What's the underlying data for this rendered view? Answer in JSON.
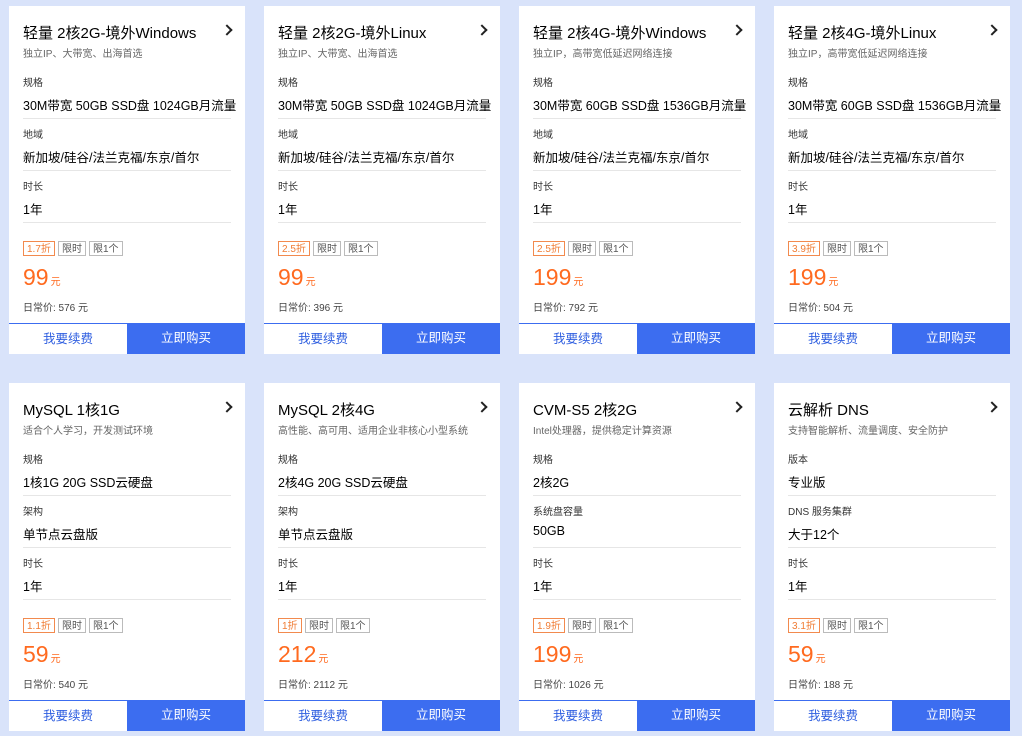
{
  "cards": [
    {
      "title": "轻量 2核2G-境外Windows",
      "subtitle": "独立IP、大带宽、出海首选",
      "row1_label": "规格",
      "row1_value": "30M带宽 50GB SSD盘 1024GB月流量",
      "row2_label": "地域",
      "row2_value": "新加坡/硅谷/法兰克福/东京/首尔",
      "row3_label": "时长",
      "row3_value": "1年",
      "discount": "1.7折",
      "tag_limited": "限时",
      "tag_limit_one": "限1个",
      "price": "99",
      "price_unit": "元",
      "original_price": "日常价: 576 元",
      "renew_label": "我要续费",
      "buy_label": "立即购买"
    },
    {
      "title": "轻量 2核2G-境外Linux",
      "subtitle": "独立IP、大带宽、出海首选",
      "row1_label": "规格",
      "row1_value": "30M带宽 50GB SSD盘 1024GB月流量",
      "row2_label": "地域",
      "row2_value": "新加坡/硅谷/法兰克福/东京/首尔",
      "row3_label": "时长",
      "row3_value": "1年",
      "discount": "2.5折",
      "tag_limited": "限时",
      "tag_limit_one": "限1个",
      "price": "99",
      "price_unit": "元",
      "original_price": "日常价: 396 元",
      "renew_label": "我要续费",
      "buy_label": "立即购买"
    },
    {
      "title": "轻量 2核4G-境外Windows",
      "subtitle": "独立IP，高带宽低延迟网络连接",
      "row1_label": "规格",
      "row1_value": "30M带宽 60GB SSD盘 1536GB月流量",
      "row2_label": "地域",
      "row2_value": "新加坡/硅谷/法兰克福/东京/首尔",
      "row3_label": "时长",
      "row3_value": "1年",
      "discount": "2.5折",
      "tag_limited": "限时",
      "tag_limit_one": "限1个",
      "price": "199",
      "price_unit": "元",
      "original_price": "日常价: 792 元",
      "renew_label": "我要续费",
      "buy_label": "立即购买"
    },
    {
      "title": "轻量 2核4G-境外Linux",
      "subtitle": "独立IP，高带宽低延迟网络连接",
      "row1_label": "规格",
      "row1_value": "30M带宽 60GB SSD盘 1536GB月流量",
      "row2_label": "地域",
      "row2_value": "新加坡/硅谷/法兰克福/东京/首尔",
      "row3_label": "时长",
      "row3_value": "1年",
      "discount": "3.9折",
      "tag_limited": "限时",
      "tag_limit_one": "限1个",
      "price": "199",
      "price_unit": "元",
      "original_price": "日常价: 504 元",
      "renew_label": "我要续费",
      "buy_label": "立即购买"
    },
    {
      "title": "MySQL 1核1G",
      "subtitle": "适合个人学习，开发测试环境",
      "row1_label": "规格",
      "row1_value": "1核1G 20G SSD云硬盘",
      "row2_label": "架构",
      "row2_value": "单节点云盘版",
      "row3_label": "时长",
      "row3_value": "1年",
      "discount": "1.1折",
      "tag_limited": "限时",
      "tag_limit_one": "限1个",
      "price": "59",
      "price_unit": "元",
      "original_price": "日常价: 540 元",
      "renew_label": "我要续费",
      "buy_label": "立即购买"
    },
    {
      "title": "MySQL 2核4G",
      "subtitle": "高性能、高可用、适用企业非核心小型系统",
      "row1_label": "规格",
      "row1_value": "2核4G 20G SSD云硬盘",
      "row2_label": "架构",
      "row2_value": "单节点云盘版",
      "row3_label": "时长",
      "row3_value": "1年",
      "discount": "1折",
      "tag_limited": "限时",
      "tag_limit_one": "限1个",
      "price": "212",
      "price_unit": "元",
      "original_price": "日常价: 2112 元",
      "renew_label": "我要续费",
      "buy_label": "立即购买"
    },
    {
      "title": "CVM-S5 2核2G",
      "subtitle": "Intel处理器，提供稳定计算资源",
      "row1_label": "规格",
      "row1_value": "2核2G",
      "row2_label": "系统盘容量",
      "row2_value": "50GB",
      "row3_label": "时长",
      "row3_value": "1年",
      "discount": "1.9折",
      "tag_limited": "限时",
      "tag_limit_one": "限1个",
      "price": "199",
      "price_unit": "元",
      "original_price": "日常价: 1026 元",
      "renew_label": "我要续费",
      "buy_label": "立即购买"
    },
    {
      "title": "云解析 DNS",
      "subtitle": "支持智能解析、流量调度、安全防护",
      "row1_label": "版本",
      "row1_value": "专业版",
      "row2_label": "DNS 服务集群",
      "row2_value": "大于12个",
      "row3_label": "时长",
      "row3_value": "1年",
      "discount": "3.1折",
      "tag_limited": "限时",
      "tag_limit_one": "限1个",
      "price": "59",
      "price_unit": "元",
      "original_price": "日常价: 188 元",
      "renew_label": "我要续费",
      "buy_label": "立即购买"
    }
  ],
  "colors": {
    "page_background": "#d9e3fa",
    "accent_blue": "#3c6df0",
    "price_orange": "#ff6a1f",
    "discount_orange": "#f07c34"
  }
}
